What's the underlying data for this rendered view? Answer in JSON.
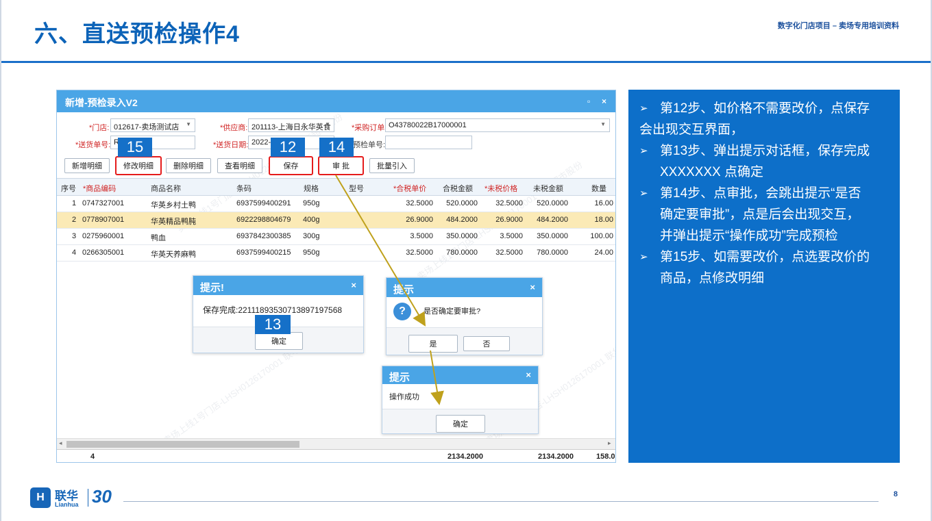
{
  "slide": {
    "title": "六、直送预检操作4",
    "subtitle": "数字化门店项目 – 卖场专用培训资料",
    "page_number": "8",
    "logo": {
      "cn": "联华",
      "en": "Lianhua",
      "anniv": "30"
    }
  },
  "app": {
    "window_title": "新增-预检录入V2",
    "controls": {
      "restore": "▫",
      "close": "×"
    },
    "form": {
      "store_label": "*门店:",
      "store_value": "012617-卖场测试店",
      "supplier_label": "*供应商:",
      "supplier_value": "201113-上海日永华英食",
      "po_label": "*采购订单:",
      "po_value": "O43780022B17000001",
      "delivery_no_label": "*送货单号:",
      "delivery_no_value": "R",
      "delivery_date_label": "*送货日期:",
      "delivery_date_value": "2022-",
      "precheck_no_label": "预检单号:",
      "precheck_no_value": ""
    },
    "toolbar": {
      "add_detail": "新增明细",
      "edit_detail": "修改明细",
      "delete_detail": "删除明细",
      "view_detail": "查看明细",
      "save": "保存",
      "approve": "审 批",
      "batch_import": "批量引入"
    },
    "grid": {
      "headers": [
        "序号",
        "*商品编码",
        "商品名称",
        "条码",
        "规格",
        "型号",
        "*合税单价",
        "合税金额",
        "*未税价格",
        "未税金额",
        "数量"
      ],
      "rows": [
        [
          "1",
          "0747327001",
          "华英乡村土鸭",
          "6937599400291",
          "950g",
          "",
          "32.5000",
          "520.0000",
          "32.5000",
          "520.0000",
          "16.00"
        ],
        [
          "2",
          "0778907001",
          "华英精品鸭肫",
          "6922298804679",
          "400g",
          "",
          "26.9000",
          "484.2000",
          "26.9000",
          "484.2000",
          "18.00"
        ],
        [
          "3",
          "0275960001",
          "鸭血",
          "6937842300385",
          "300g",
          "",
          "3.5000",
          "350.0000",
          "3.5000",
          "350.0000",
          "100.00"
        ],
        [
          "4",
          "0266305001",
          "华英天养麻鸭",
          "6937599400215",
          "950g",
          "",
          "32.5000",
          "780.0000",
          "32.5000",
          "780.0000",
          "24.00"
        ]
      ],
      "footer": {
        "count": "4",
        "tax_total": "2134.2000",
        "untaxed_total": "2134.2000",
        "qty_total": "158.0"
      }
    },
    "watermark_text": "卖场上线1号门店-LHSH0126170001 联华超市股份"
  },
  "dialogs": {
    "save_done": {
      "title": "提示!",
      "close": "×",
      "message": "保存完成:221118935307138971975​68",
      "ok": "确定"
    },
    "confirm_approve": {
      "title": "提示",
      "close": "×",
      "message": "是否确定要审批?",
      "yes": "是",
      "no": "否"
    },
    "op_success": {
      "title": "提示",
      "close": "×",
      "message": "操作成功",
      "ok": "确定"
    }
  },
  "steps": {
    "s12": "12",
    "s13": "13",
    "s14": "14",
    "s15": "15"
  },
  "instructions": [
    {
      "lines": [
        "第12步、如价格不需要改价，点保存",
        "会出现交互界面，"
      ]
    },
    {
      "lines": [
        "第13步、弹出提示对话框，保存完成",
        "XXXXXXX 点确定"
      ]
    },
    {
      "lines": [
        "第14步、点审批，会跳出提示“是否",
        "确定要审批”，点是后会出现交互，",
        "并弹出提示“操作成功”完成预检"
      ]
    },
    {
      "lines": [
        "第15步、如需要改价，点选要改价的",
        "商品，点修改明细"
      ]
    }
  ],
  "colors": {
    "accent": "#0d6fc9",
    "titlebar": "#4aa5e6",
    "highlight_red": "#e51b1b",
    "highlight_gold": "#bfa11c",
    "selected_row": "#fbeab6"
  },
  "icons": [
    "question-icon",
    "arrow-bullet-icon",
    "close-icon",
    "restore-icon",
    "dropdown-icon"
  ]
}
